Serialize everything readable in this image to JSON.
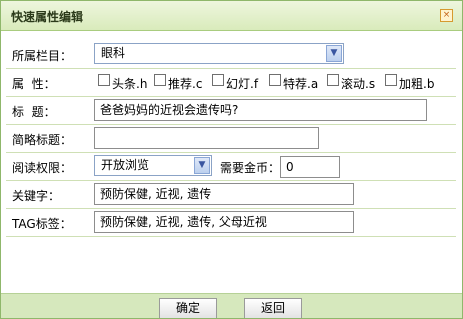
{
  "dialog": {
    "title": "快速属性编辑",
    "close_glyph": "×"
  },
  "fields": {
    "column": {
      "label": "所属栏目：",
      "selected": "眼科"
    },
    "attributes": {
      "label": "属  性：",
      "options": [
        {
          "label": "头条.h",
          "checked": false
        },
        {
          "label": "推荐.c",
          "checked": false
        },
        {
          "label": "幻灯.f",
          "checked": false
        },
        {
          "label": "特荐.a",
          "checked": false
        },
        {
          "label": "滚动.s",
          "checked": false
        },
        {
          "label": "加粗.b",
          "checked": false
        }
      ]
    },
    "title": {
      "label": "标  题：",
      "value": "爸爸妈妈的近视会遗传吗?"
    },
    "short_title": {
      "label": "简略标题：",
      "value": ""
    },
    "permission": {
      "label": "阅读权限：",
      "selected": "开放浏览",
      "coins_label": "需要金币：",
      "coins_value": "0"
    },
    "keywords": {
      "label": "关键字：",
      "value": "预防保健, 近视, 遗传"
    },
    "tags": {
      "label": "TAG标签：",
      "value": "预防保健, 近视, 遗传, 父母近视"
    }
  },
  "buttons": {
    "ok": "确定",
    "back": "返回"
  }
}
